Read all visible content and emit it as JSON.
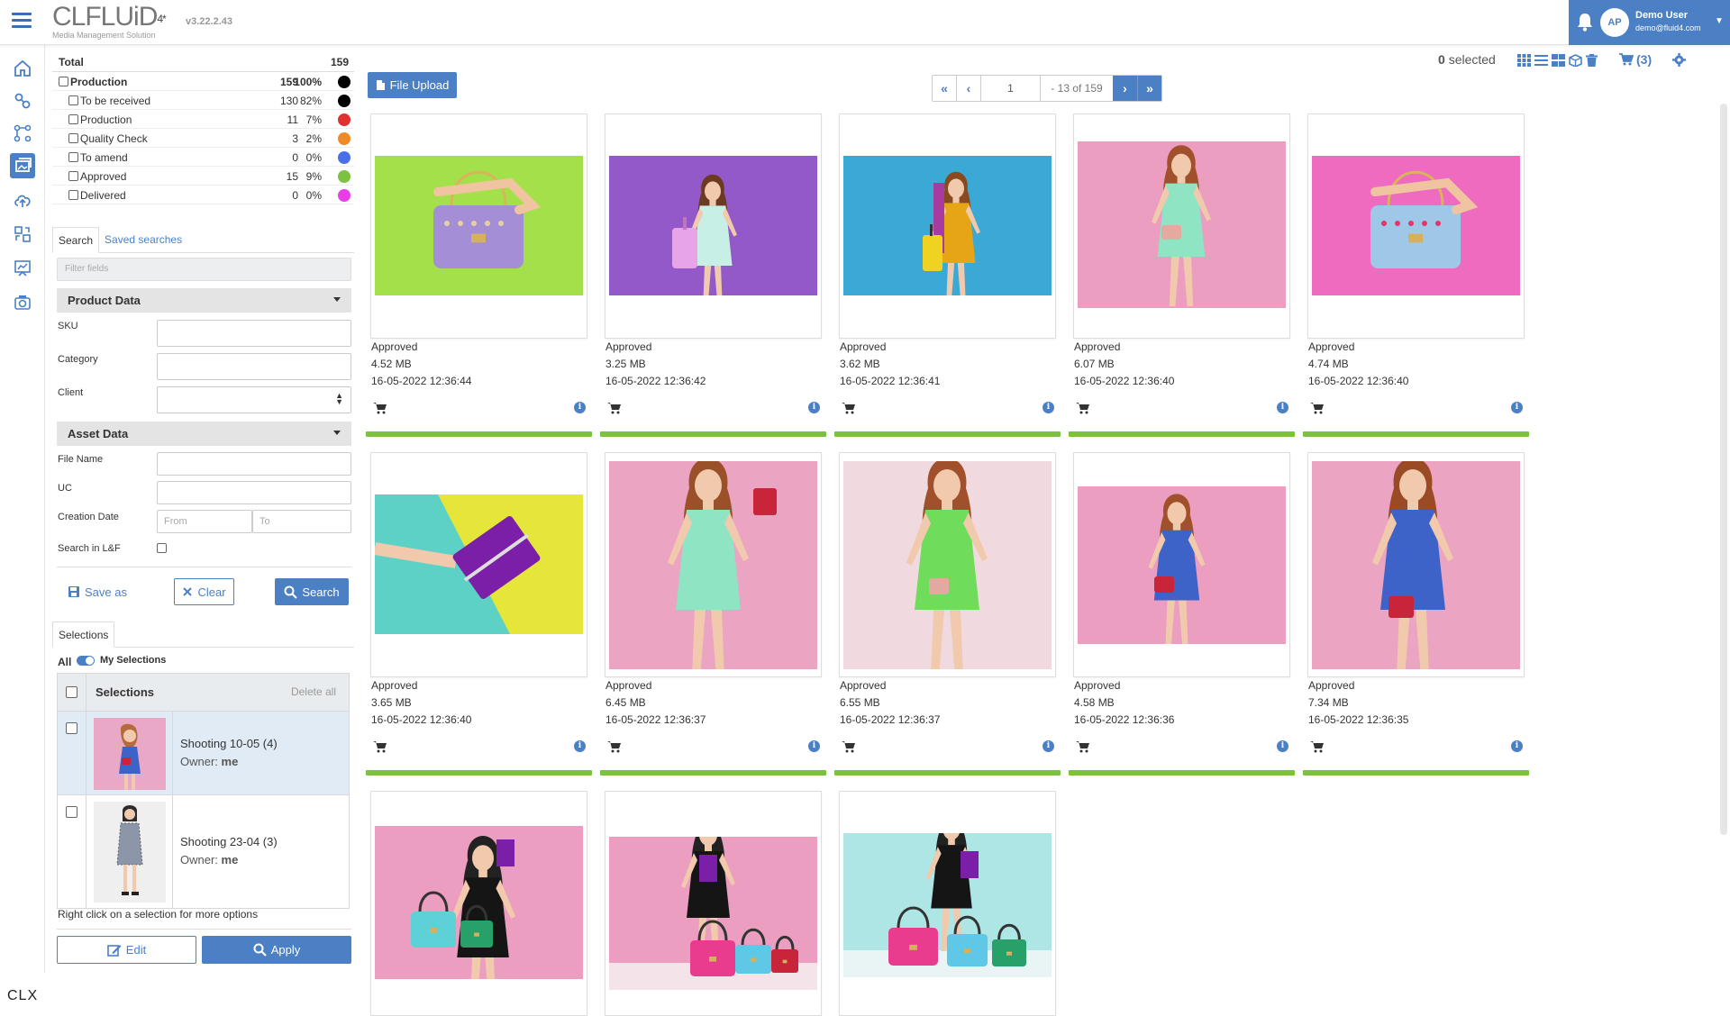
{
  "app": {
    "logo_text": "CLFLUiD",
    "logo_sup": "4*",
    "tagline": "Media Management Solution",
    "version": "v3.22.2.43",
    "footer_brand": "CLX"
  },
  "user": {
    "initials": "AP",
    "name": "Demo User",
    "email": "demo@fluid4.com"
  },
  "stats": {
    "total_label": "Total",
    "total_value": "159",
    "rows": [
      {
        "label": "Production",
        "count": "159",
        "pct": "100%",
        "color": "#000000",
        "bold": true
      },
      {
        "label": "To be received",
        "count": "130",
        "pct": "82%",
        "color": "#000000"
      },
      {
        "label": "Production",
        "count": "11",
        "pct": "7%",
        "color": "#e03030"
      },
      {
        "label": "Quality Check",
        "count": "3",
        "pct": "2%",
        "color": "#f08a24"
      },
      {
        "label": "To amend",
        "count": "0",
        "pct": "0%",
        "color": "#4b6fe8"
      },
      {
        "label": "Approved",
        "count": "15",
        "pct": "9%",
        "color": "#7cc240"
      },
      {
        "label": "Delivered",
        "count": "0",
        "pct": "0%",
        "color": "#e83ee8"
      }
    ]
  },
  "search": {
    "tabs": [
      "Search",
      "Saved searches"
    ],
    "filter_placeholder": "Filter fields",
    "product_section": "Product Data",
    "asset_section": "Asset Data",
    "labels": {
      "sku": "SKU",
      "category": "Category",
      "client": "Client",
      "file_name": "File Name",
      "uc": "UC",
      "creation_date": "Creation Date",
      "search_lf": "Search in L&F"
    },
    "date_from": "From",
    "date_to": "To",
    "save_as": "Save as",
    "clear": "Clear",
    "search": "Search"
  },
  "selections": {
    "tab": "Selections",
    "all_label": "All",
    "my_label": "My Selections",
    "header": "Selections",
    "delete_all": "Delete all",
    "items": [
      {
        "name": "Shooting 10-05 (4)",
        "owner_label": "Owner:",
        "owner": "me"
      },
      {
        "name": "Shooting 23-04 (3)",
        "owner_label": "Owner:",
        "owner": "me"
      }
    ],
    "hint": "Right click on a selection for more options",
    "edit": "Edit",
    "apply": "Apply"
  },
  "toolbar": {
    "file_upload": "File Upload",
    "page_value": "1",
    "page_range": "- 13 of 159",
    "selected_count": "0",
    "selected_label": "selected",
    "cart_count": "(3)"
  },
  "assets": [
    {
      "status": "Approved",
      "size": "4.52 MB",
      "date": "16-05-2022 12:36:44",
      "scene": "bag-green"
    },
    {
      "status": "Approved",
      "size": "3.25 MB",
      "date": "16-05-2022 12:36:42",
      "scene": "woman-purple"
    },
    {
      "status": "Approved",
      "size": "3.62 MB",
      "date": "16-05-2022 12:36:41",
      "scene": "woman-blue"
    },
    {
      "status": "Approved",
      "size": "6.07 MB",
      "date": "16-05-2022 12:36:40",
      "scene": "woman-pink-mint"
    },
    {
      "status": "Approved",
      "size": "4.74 MB",
      "date": "16-05-2022 12:36:40",
      "scene": "bag-pink"
    },
    {
      "status": "Approved",
      "size": "3.65 MB",
      "date": "16-05-2022 12:36:40",
      "scene": "clutch-yellow"
    },
    {
      "status": "Approved",
      "size": "6.45 MB",
      "date": "16-05-2022 12:36:37",
      "scene": "woman-mint-redbag"
    },
    {
      "status": "Approved",
      "size": "6.55 MB",
      "date": "16-05-2022 12:36:37",
      "scene": "woman-green"
    },
    {
      "status": "Approved",
      "size": "4.58 MB",
      "date": "16-05-2022 12:36:36",
      "scene": "woman-blue-dress-wide"
    },
    {
      "status": "Approved",
      "size": "7.34 MB",
      "date": "16-05-2022 12:36:35",
      "scene": "woman-blue-dress"
    },
    {
      "status": "",
      "size": "",
      "date": "",
      "scene": "woman-black-bags"
    },
    {
      "status": "",
      "size": "",
      "date": "",
      "scene": "bags-pink"
    },
    {
      "status": "",
      "size": "",
      "date": "",
      "scene": "woman-black-teal"
    }
  ],
  "colors": {
    "accent": "#4b80c4",
    "approved_bar": "#7cc240"
  }
}
